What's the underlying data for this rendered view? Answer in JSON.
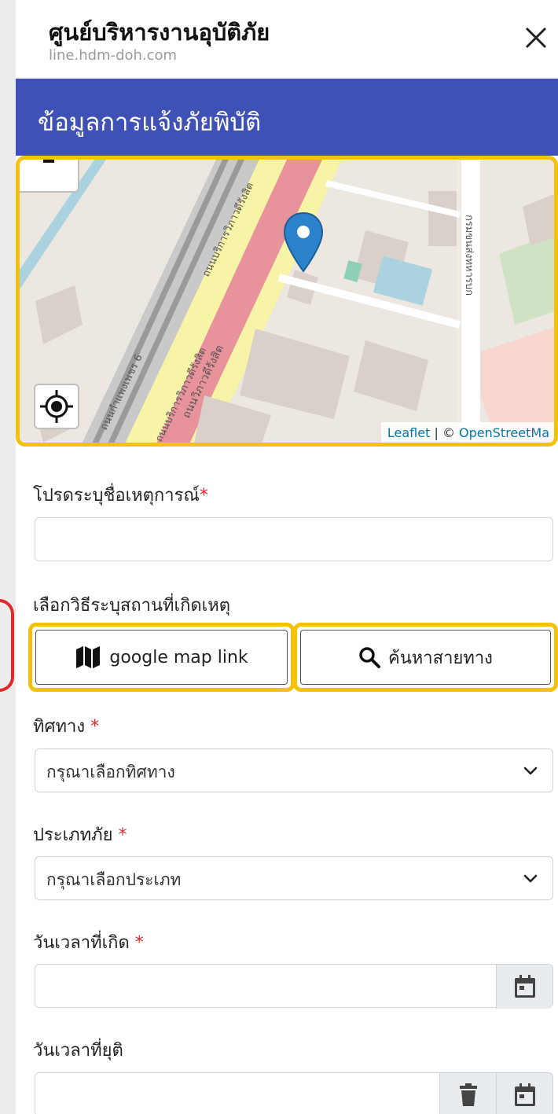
{
  "topbar": {
    "title": "ศูนย์บริหารงานอุบัติภัย",
    "url": "line.hdm-doh.com",
    "close_icon": "close-icon"
  },
  "header": {
    "title": "ข้อมูลการแจ้งภัยพิบัติ"
  },
  "map": {
    "zoom_out_icon": "minus-icon",
    "locate_icon": "crosshair-icon",
    "marker_icon": "map-pin-icon",
    "attribution_leaflet": "Leaflet",
    "attribution_sep": " | © ",
    "attribution_osm": "OpenStreetMa",
    "street_labels": [
      "ถนนวิภาวดีรังสิต",
      "ถนนบริการวิภาวดีรังสิต",
      "ถนนกำแพงเพชร 6",
      "ถนนบริการวิภาวดีรังสิต",
      "กรมขนส่งทหารบก"
    ]
  },
  "form": {
    "event_name_label": "โปรดระบุชื่อเหตุการณ์",
    "required_mark": "*",
    "event_name_value": "",
    "location_method_label": "เลือกวิธีระบุสถานที่เกิดเหตุ",
    "gmap_button": "google map link",
    "gmap_icon": "map-icon",
    "search_button": "ค้นหาสายทาง",
    "search_icon": "search-icon",
    "direction_label": "ทิศทาง",
    "direction_value": "กรุณาเลือกทิศทาง",
    "type_label": "ประเภทภัย",
    "type_value": "กรุณาเลือกประเภท",
    "start_label": "วันเวลาที่เกิด",
    "start_value": "",
    "end_label": "วันเวลาที่ยุติ",
    "end_value": "",
    "calendar_icon": "calendar-icon",
    "trash_icon": "trash-icon"
  },
  "colors": {
    "header": "#3f51b5",
    "highlight": "#f4c20d",
    "required": "#d32f2f",
    "marker": "#2b83cb"
  }
}
